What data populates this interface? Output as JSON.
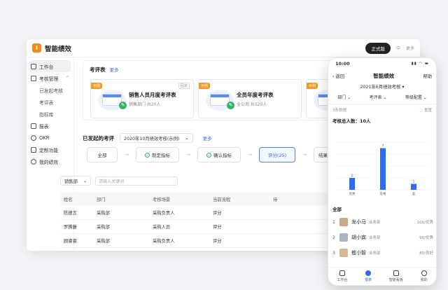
{
  "app": {
    "title": "智能绩效",
    "logo_char": "i",
    "badge": "正式版",
    "lang": "中",
    "more": "更多"
  },
  "sidebar": {
    "items": [
      {
        "label": "工作台",
        "active": true
      },
      {
        "label": "考核管理",
        "chevron": "^"
      },
      {
        "label": "已发起考核",
        "sub": true
      },
      {
        "label": "考评表",
        "sub": true
      },
      {
        "label": "指标库",
        "sub": true
      },
      {
        "label": "报表"
      },
      {
        "label": "OKR"
      },
      {
        "label": "定制功能"
      },
      {
        "label": "我的绩效"
      }
    ]
  },
  "templates": {
    "title": "考评表",
    "more": "更多",
    "items": [
      {
        "tag": "示例",
        "fix": "固定",
        "name": "销售人员月度考评表",
        "desc": "销售部门 共20人"
      },
      {
        "tag": "示例",
        "fix": "",
        "name": "全员年度考评表",
        "desc": "全公司 共120人"
      },
      {
        "tag": "示例",
        "fix": "",
        "name": "",
        "desc": ""
      }
    ]
  },
  "initiated": {
    "title": "已发起的考评",
    "select": "2020年10月绩效考核(示例)",
    "more": "更多"
  },
  "flow": {
    "steps": [
      "全部",
      "制定指标",
      "确认指标",
      "评分(25)",
      "结果("
    ]
  },
  "filter": {
    "dept": "销售部",
    "search_placeholder": "请输入关键词"
  },
  "table": {
    "headers": [
      "姓名",
      "部门",
      "考核场景",
      "当前流程",
      "待"
    ],
    "rows": [
      [
        "陈德言",
        "采购部",
        "采购负责人",
        "评分",
        ""
      ],
      [
        "罗腾藤",
        "采购部",
        "采购人员",
        "评分",
        ""
      ],
      [
        "顾睿睿",
        "采购部",
        "采购负责人",
        "评分",
        ""
      ]
    ]
  },
  "phone": {
    "time": "10:00",
    "signal": "▮▮ ◠ ▬",
    "back": "返回",
    "title": "智能绩效",
    "help": "帮助",
    "period": "2021年6月绩效考核 ▾",
    "filters": [
      "部门 ⌄",
      "考评表 ⌄",
      "等级配置 ⌄"
    ],
    "count": "3条数据",
    "refresh": "◌ 重置",
    "total_label": "考核总人数：10人",
    "all_label": "全部",
    "employees": [
      {
        "rank": "1",
        "name": "龙小马",
        "dept": "业务部",
        "score": "100/优秀"
      },
      {
        "rank": "2",
        "name": "胡小宾",
        "dept": "业务部",
        "score": "90/优秀"
      },
      {
        "rank": "3",
        "name": "敖小智",
        "dept": "业务部",
        "score": "80/良好"
      }
    ],
    "tabs": [
      "工作台",
      "报表",
      "智能看板",
      "我的"
    ]
  },
  "chart_data": {
    "type": "bar",
    "categories": [
      "优秀",
      "及格",
      "差"
    ],
    "values": [
      2,
      7,
      1
    ],
    "ylim": [
      0,
      8
    ],
    "color": "#2f6cf6"
  }
}
